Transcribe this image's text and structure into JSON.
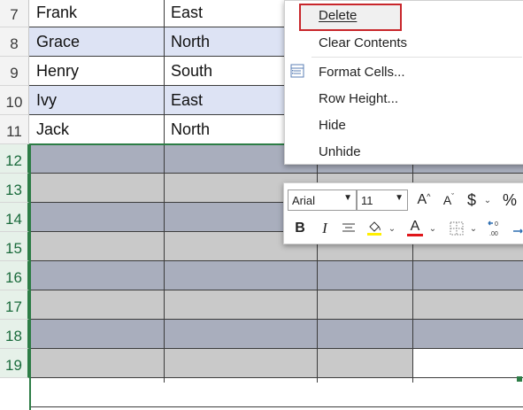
{
  "rows": [
    {
      "num": "7",
      "name": "Frank",
      "region": "East"
    },
    {
      "num": "8",
      "name": "Grace",
      "region": "North"
    },
    {
      "num": "9",
      "name": "Henry",
      "region": "South"
    },
    {
      "num": "10",
      "name": "Ivy",
      "region": "East"
    },
    {
      "num": "11",
      "name": "Jack",
      "region": "North"
    }
  ],
  "selected_rows": [
    "12",
    "13",
    "14",
    "15",
    "16",
    "17",
    "18",
    "19"
  ],
  "context_menu": {
    "delete": "Delete",
    "clear_contents": "Clear Contents",
    "format_cells": "Format Cells...",
    "row_height": "Row Height...",
    "hide": "Hide",
    "unhide": "Unhide"
  },
  "mini_toolbar": {
    "font_name": "Arial",
    "font_size": "11",
    "grow_font": "A",
    "shrink_font": "A",
    "currency": "$",
    "percent": "%",
    "bold": "B",
    "italic": "I",
    "font_color": "A"
  },
  "colors": {
    "row_fill_dark": "#a9aebd",
    "row_fill_light": "#c9c9c9",
    "band_fill": "#dde3f4",
    "highlight_yellow": "#ffef00",
    "font_red": "#e0161a",
    "delete_outline": "#c8262b"
  }
}
